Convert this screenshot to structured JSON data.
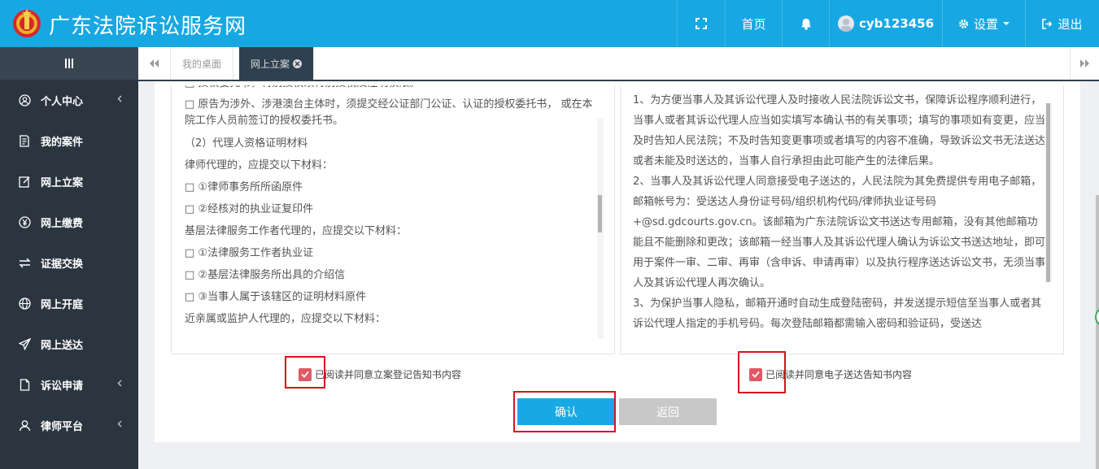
{
  "header": {
    "title": "广东法院诉讼服务网",
    "nav": {
      "home": "首页",
      "username": "cyb123456",
      "settings": "设置",
      "logout": "退出"
    }
  },
  "sidebar": {
    "items": [
      {
        "label": "个人中心",
        "has_children": true
      },
      {
        "label": "我的案件",
        "has_children": false
      },
      {
        "label": "网上立案",
        "has_children": false
      },
      {
        "label": "网上缴费",
        "has_children": false
      },
      {
        "label": "证据交换",
        "has_children": false
      },
      {
        "label": "网上开庭",
        "has_children": false
      },
      {
        "label": "网上送达",
        "has_children": false
      },
      {
        "label": "诉讼申请",
        "has_children": true
      },
      {
        "label": "律师平台",
        "has_children": true
      }
    ]
  },
  "tabs": {
    "items": [
      {
        "label": "我的桌面",
        "active": false
      },
      {
        "label": "网上立案",
        "active": true
      }
    ]
  },
  "left_panel": {
    "lines": [
      "□ 授权委托书，特别授权须特别授权及注明权限。",
      "□ 原告为涉外、涉港澳台主体时，须提交经公证部门公证、认证的授权委托书， 或在本院工作人员前签订的授权委托书。",
      "（2）代理人资格证明材料",
      "律师代理的，应提交以下材料：",
      "□ ①律师事务所所函原件",
      "□ ②经核对的执业证复印件",
      "基层法律服务工作者代理的，应提交以下材料：",
      "□ ①法律服务工作者执业证",
      "□ ②基层法律服务所出具的介绍信",
      "□ ③当事人属于该辖区的证明材料原件",
      "近亲属或监护人代理的，应提交以下材料："
    ]
  },
  "right_panel": {
    "paragraphs": [
      "1、为方便当事人及其诉讼代理人及时接收人民法院诉讼文书，保障诉讼程序顺利进行，当事人或者其诉讼代理人应当如实填写本确认书的有关事项；填写的事项如有变更，应当及时告知人民法院；不及时告知变更事项或者填写的内容不准确，导致诉讼文书无法送达或者未能及时送达的，当事人自行承担由此可能产生的法律后果。",
      "2、当事人及其诉讼代理人同意接受电子送达的，人民法院为其免费提供专用电子邮箱，邮箱帐号为：受送达人身份证号码/组织机构代码/律师执业证号码+@sd.gdcourts.gov.cn。该邮箱为广东法院诉讼文书送达专用邮箱，没有其他邮箱功能且不能删除和更改；该邮箱一经当事人及其诉讼代理人确认为诉讼文书送达地址，即可用于案件一审、二审、再审（含申诉、申请再审）以及执行程序送达诉讼文书，无须当事人及其诉讼代理人再次确认。",
      "3、为保护当事人隐私，邮箱开通时自动生成登陆密码，并发送提示短信至当事人或者其诉讼代理人指定的手机号码。每次登陆邮箱都需输入密码和验证码，受送达"
    ]
  },
  "agreements": {
    "filing": "已阅读并同意立案登记告知书内容",
    "delivery": "已阅读并同意电子送达告知书内容"
  },
  "buttons": {
    "confirm": "确认",
    "back": "返回"
  },
  "colors": {
    "header": "#17a8e3",
    "sidebar": "#2b3540",
    "active_tab": "#2f4050",
    "confirm": "#18a9e5",
    "back": "#c8c8c8",
    "checkbox": "#e05a66",
    "highlight": "#d5141c"
  }
}
